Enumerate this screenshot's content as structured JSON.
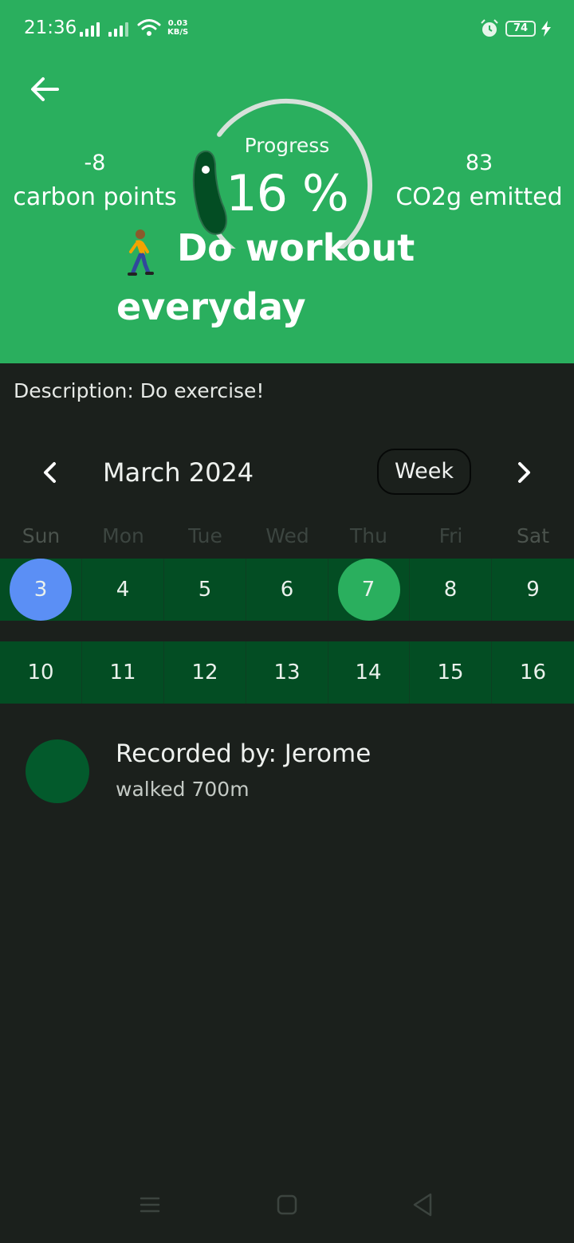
{
  "status_bar": {
    "time": "21:36",
    "net_speed_value": "0.03",
    "net_speed_unit": "KB/S",
    "battery": "74"
  },
  "header": {
    "carbon_points_value": "-8",
    "carbon_points_label": "carbon points",
    "progress_label": "Progress",
    "progress_value": "16 %",
    "progress_fraction": 0.16,
    "co2_value": "83",
    "co2_label": "CO2g emitted",
    "title_emoji": "person-walking-icon",
    "title_line1": "Do workout",
    "title_line2": "everyday"
  },
  "description": "Description: Do exercise!",
  "calendar": {
    "month_title": "March 2024",
    "view_toggle": "Week",
    "weekdays": [
      "Sun",
      "Mon",
      "Tue",
      "Wed",
      "Thu",
      "Fri",
      "Sat"
    ],
    "weeks": [
      [
        "3",
        "4",
        "5",
        "6",
        "7",
        "8",
        "9"
      ],
      [
        "10",
        "11",
        "12",
        "13",
        "14",
        "15",
        "16"
      ]
    ],
    "selected_day": "3",
    "completed_day": "7"
  },
  "record": {
    "title": "Recorded by: Jerome",
    "subtitle": "walked 700m"
  },
  "colors": {
    "header_green": "#2aaf5e",
    "background": "#1b201c",
    "week_row": "#034d23",
    "selected_day": "#5b8ff5",
    "completed_day": "#2aaf5e",
    "gauge_track": "#d7e1da",
    "gauge_handle": "#034d23"
  }
}
